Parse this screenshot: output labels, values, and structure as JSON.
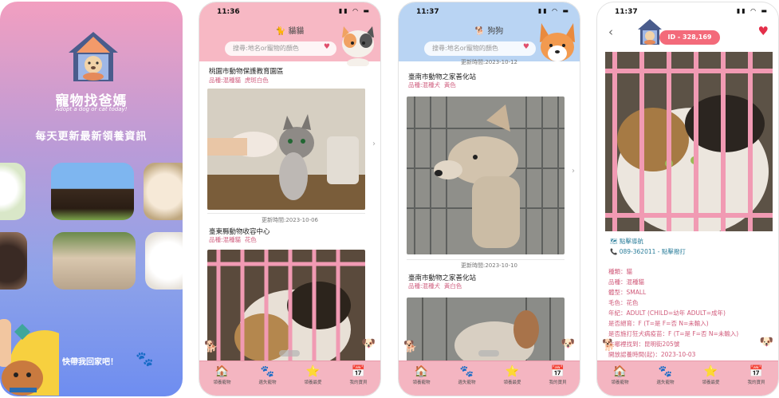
{
  "promo": {
    "app_name": "寵物找爸媽",
    "tagline": "Adopt a dog or cat today!",
    "headline": "每天更新最新領養資訊",
    "footer": "快帶我回家吧！"
  },
  "tabs": [
    {
      "label": "領養寵物",
      "icon": "house-pet-icon"
    },
    {
      "label": "遺失寵物",
      "icon": "lost-pet-icon"
    },
    {
      "label": "領養最愛",
      "icon": "star-icon"
    },
    {
      "label": "我的寶貝",
      "icon": "calendar-icon"
    }
  ],
  "cats_screen": {
    "time": "11:36",
    "title": "貓貓",
    "search_placeholder": "搜尋:地名or寵物的顏色",
    "cards": [
      {
        "shelter": "桃園市動物保護教育園區",
        "breed": "品種:混種貓",
        "color": "虎斑白色",
        "date": ""
      },
      {
        "shelter": "臺東縣動物收容中心",
        "breed": "品種:混種貓",
        "color": "花色",
        "date": "更新時間:2023-10-06"
      }
    ]
  },
  "dogs_screen": {
    "time": "11:37",
    "title": "狗狗",
    "search_placeholder": "搜尋:地名or寵物的顏色",
    "cards": [
      {
        "shelter": "臺南市動物之家善化站",
        "breed": "品種:混種犬",
        "color": "黃色",
        "date": "更新時間:2023-10-12"
      },
      {
        "shelter": "臺南市動物之家善化站",
        "breed": "品種:混種犬",
        "color": "黃白色",
        "date": "更新時間:2023-10-10"
      }
    ]
  },
  "detail_screen": {
    "time": "11:37",
    "id_label": "ID - 328,169",
    "nav_label": "點擊導航",
    "phone_label": "089-362011 - 點擊撥打",
    "attributes": [
      "種類：貓",
      "品種：混種貓",
      "體型：SMALL",
      "毛色：花色",
      "年紀：ADULT (CHILD=幼年 ADULT=成年)",
      "是否絕育：F (T=是 F=否 N=未輸入)",
      "是否施打狂犬病疫苗：F (T=是 F=否 N=未輸入)",
      "在哪裡找到：昆明街205號",
      "開放認養時間(起)：2023-10-03"
    ]
  },
  "colors": {
    "pink_header": "#f7b8c4",
    "blue_header": "#b9d4f3",
    "tabbar": "#f4b5c1",
    "accent": "#f36a7a"
  }
}
